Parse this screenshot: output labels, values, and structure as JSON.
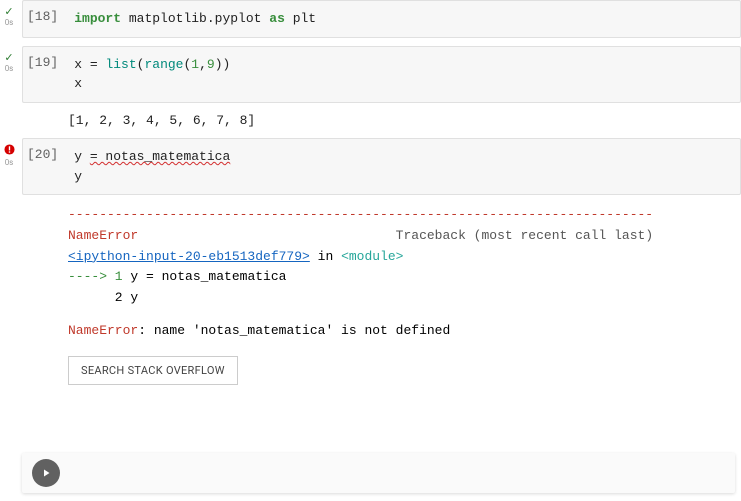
{
  "cells": [
    {
      "status": "ok",
      "time": "0s",
      "prompt": "[18]",
      "code": {
        "import_kw": "import",
        "module": "matplotlib.pyplot",
        "as_kw": "as",
        "alias": "plt"
      }
    },
    {
      "status": "ok",
      "time": "0s",
      "prompt": "[19]",
      "code": {
        "var": "x",
        "eq": " = ",
        "fn": "list",
        "op": "(",
        "rng": "range",
        "args": "(1,9))",
        "line2": "x"
      },
      "output": "[1, 2, 3, 4, 5, 6, 7, 8]"
    },
    {
      "status": "err",
      "time": "0s",
      "prompt": "[20]",
      "code": {
        "line1_var": "y ",
        "line1_expr": "= notas_matematica",
        "line2": "y"
      },
      "error": {
        "sep": "---------------------------------------------------------------------------",
        "name": "NameError",
        "traceback_label": "Traceback (most recent call last)",
        "frame_link": "<ipython-input-20-eb1513def779>",
        "frame_in": " in ",
        "frame_mod": "<module>",
        "arrow_line": "----> 1 y = notas_matematica",
        "line2": "      2 y",
        "final": "NameError",
        "final_msg": ": name 'notas_matematica' is not defined"
      },
      "button": "SEARCH STACK OVERFLOW"
    }
  ],
  "new_cell": {
    "placeholder": ""
  }
}
